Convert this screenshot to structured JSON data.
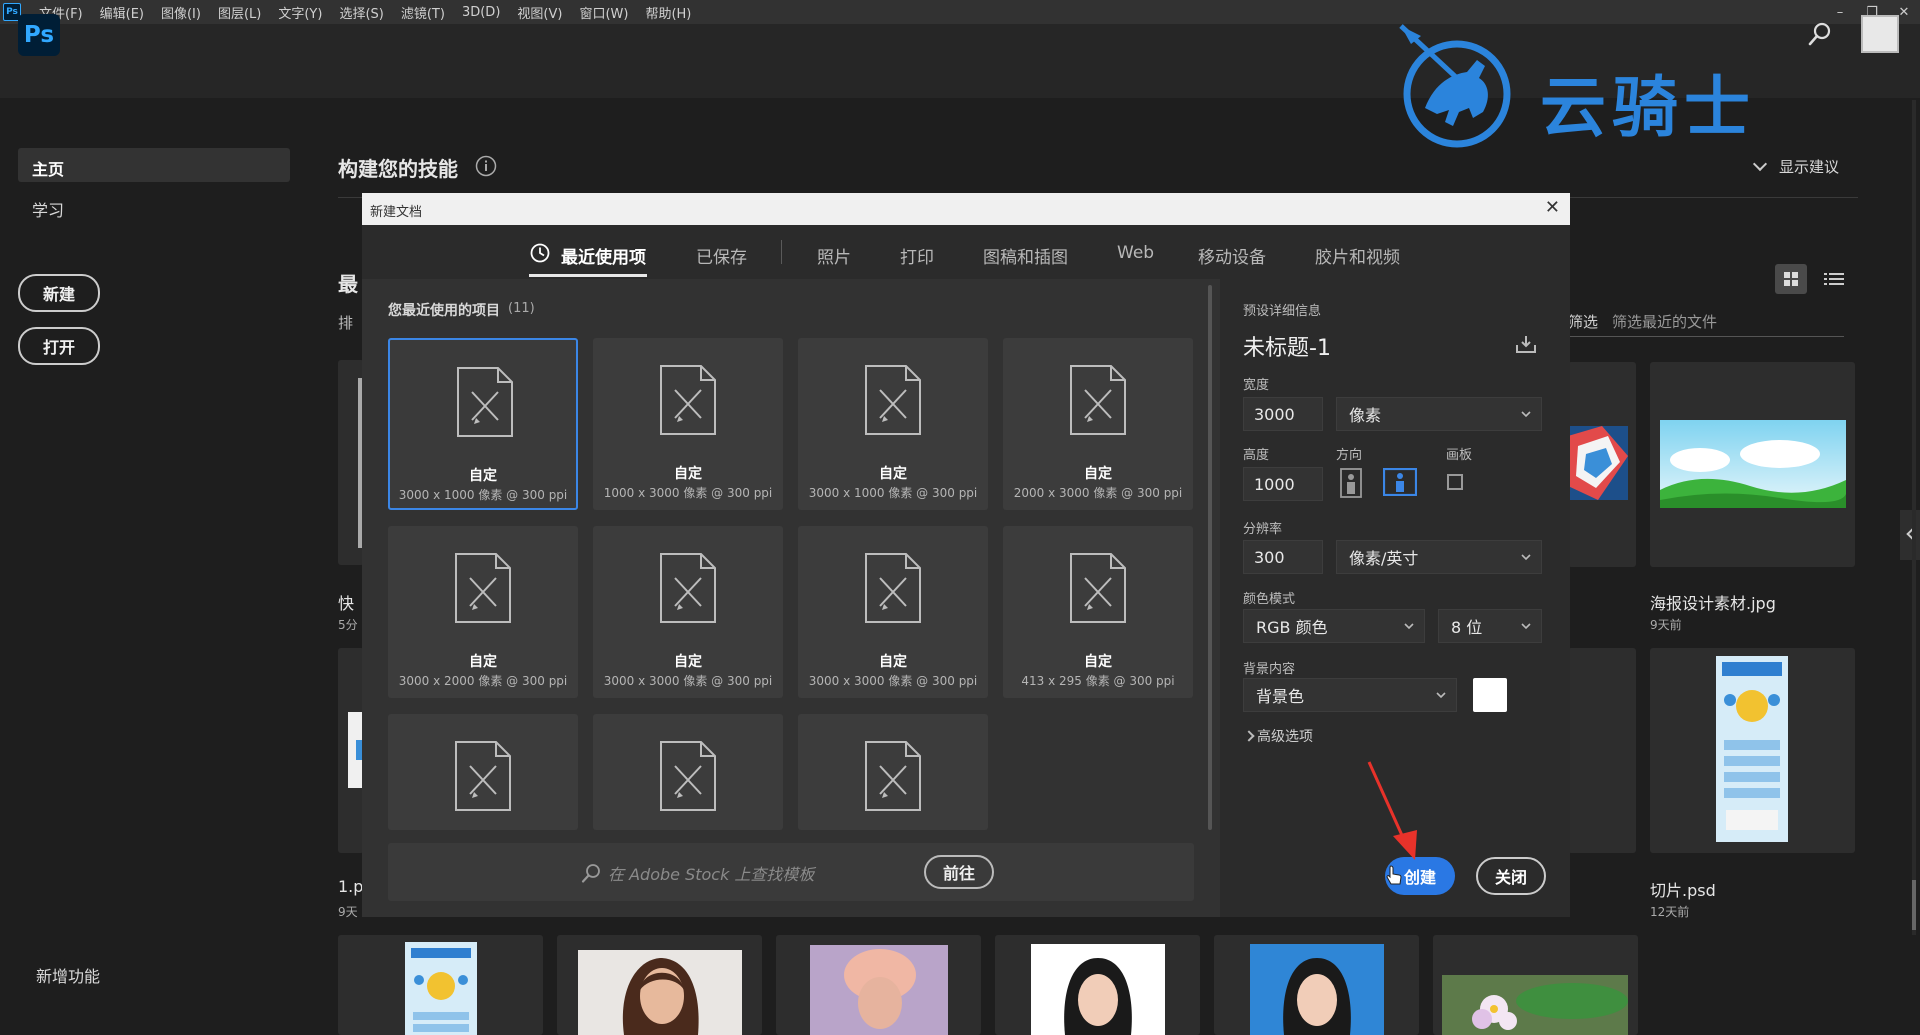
{
  "menubar": {
    "app_icon": "Ps",
    "items": [
      "文件(F)",
      "编辑(E)",
      "图像(I)",
      "图层(L)",
      "文字(Y)",
      "选择(S)",
      "滤镜(T)",
      "3D(D)",
      "视图(V)",
      "窗口(W)",
      "帮助(H)"
    ],
    "window_controls": [
      "–",
      "❐",
      "✕"
    ]
  },
  "appbar": {
    "logo": "Ps"
  },
  "watermark": {
    "text": "云骑士"
  },
  "nav": {
    "home": "主页",
    "learn": "学习",
    "new": "新建",
    "open": "打开",
    "whats_new": "新增功能"
  },
  "home": {
    "title": "构建您的技能",
    "show_suggestions": "显示建议",
    "recent_heading": "最",
    "sort_heading": "排",
    "filter_label": "筛选",
    "filter_placeholder": "筛选最近的文件",
    "partial_card1_name": "快",
    "partial_card1_time": "5分",
    "partial_card2_name": "1.p",
    "partial_card2_time": "9天",
    "card_poster": {
      "name": "海报设计素材.jpg",
      "time": "9天前"
    },
    "card_slice": {
      "name": "切片.psd",
      "time": "12天前"
    }
  },
  "dialog": {
    "title": "新建文档",
    "close": "✕",
    "tabs": [
      "最近使用项",
      "已保存",
      "照片",
      "打印",
      "图稿和插图",
      "Web",
      "移动设备",
      "胶片和视频"
    ],
    "presets_heading": "您最近使用的项目",
    "presets_count": "(11)",
    "presets": [
      {
        "name": "自定",
        "dims": "3000 x 1000 像素 @ 300 ppi"
      },
      {
        "name": "自定",
        "dims": "1000 x 3000 像素 @ 300 ppi"
      },
      {
        "name": "自定",
        "dims": "3000 x 1000 像素 @ 300 ppi"
      },
      {
        "name": "自定",
        "dims": "2000 x 3000 像素 @ 300 ppi"
      },
      {
        "name": "自定",
        "dims": "3000 x 2000 像素 @ 300 ppi"
      },
      {
        "name": "自定",
        "dims": "3000 x 3000 像素 @ 300 ppi"
      },
      {
        "name": "自定",
        "dims": "3000 x 3000 像素 @ 300 ppi"
      },
      {
        "name": "自定",
        "dims": "413 x 295 像素 @ 300 ppi"
      },
      {
        "name": "",
        "dims": ""
      },
      {
        "name": "",
        "dims": ""
      },
      {
        "name": "",
        "dims": ""
      }
    ],
    "stock_placeholder": "在 Adobe Stock 上查找模板",
    "stock_go": "前往",
    "details": {
      "heading": "预设详细信息",
      "doc_name": "未标题-1",
      "width_label": "宽度",
      "width_value": "3000",
      "width_unit": "像素",
      "height_label": "高度",
      "height_value": "1000",
      "orientation_label": "方向",
      "artboard_label": "画板",
      "resolution_label": "分辨率",
      "resolution_value": "300",
      "resolution_unit": "像素/英寸",
      "color_mode_label": "颜色模式",
      "color_mode": "RGB 颜色",
      "bit_depth": "8 位",
      "background_label": "背景内容",
      "background_value": "背景色",
      "advanced": "高级选项",
      "create": "创建",
      "close": "关闭"
    }
  },
  "colors": {
    "accent": "#2a78e4",
    "ps_blue": "#31a8ff",
    "watermark": "#2b84dc",
    "annotation": "#e8322a"
  }
}
